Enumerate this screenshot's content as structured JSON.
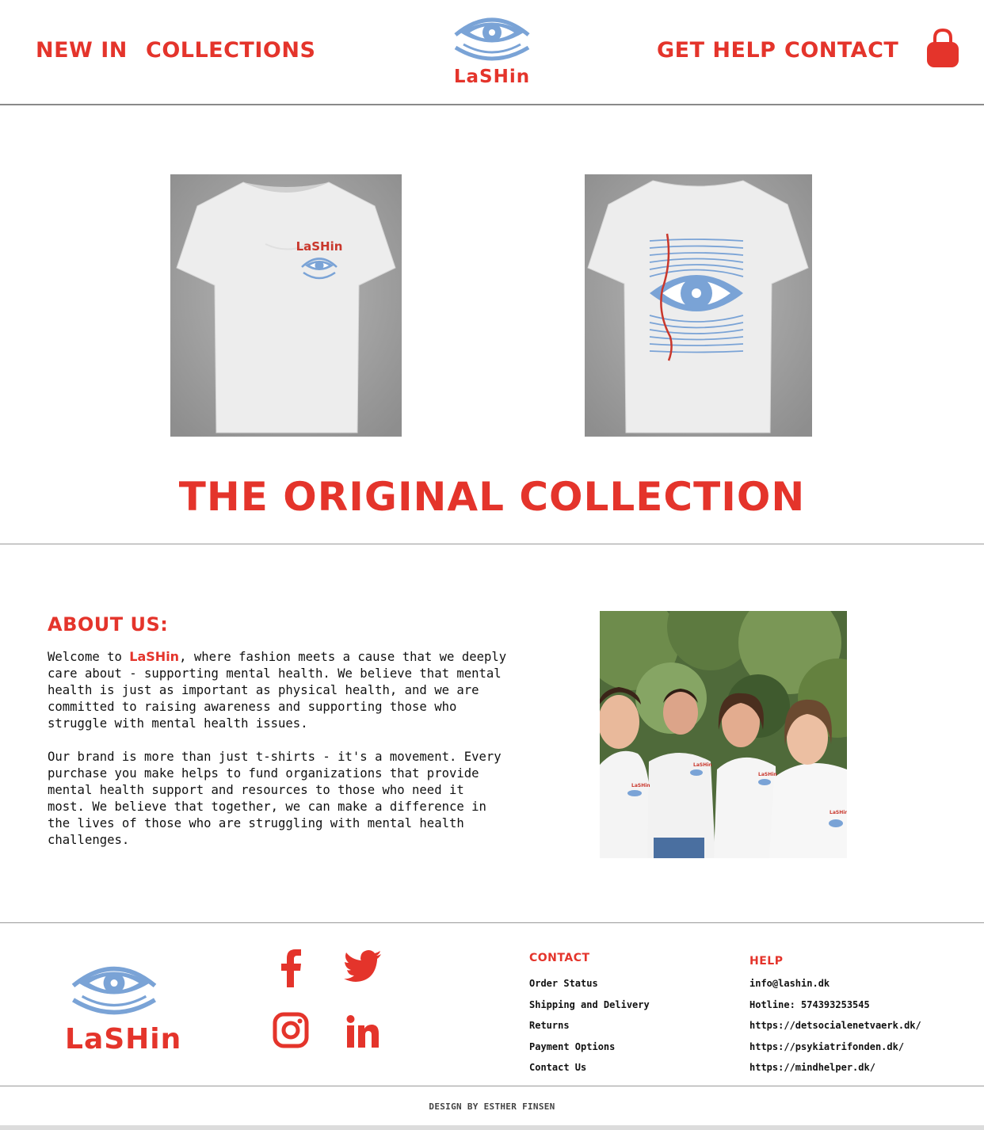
{
  "brand": {
    "name": "LaSHin",
    "accent": "#e4342b",
    "eye_blue": "#7aa3d6"
  },
  "nav": {
    "new_in": "NEW IN",
    "collections": "COLLECTIONS",
    "get_help": "GET HELP",
    "contact": "CONTACT",
    "bag_icon": "shopping-bag-icon"
  },
  "hero": {
    "products": [
      {
        "view": "front",
        "print_text": "LaSHin"
      },
      {
        "view": "back"
      }
    ],
    "title": "THE ORIGINAL COLLECTION"
  },
  "about": {
    "heading": "ABOUT US:",
    "p1_pre": "Welcome to ",
    "p1_brand": "LaSHin",
    "p1_post": ", where fashion meets a cause that we deeply care about - supporting mental health. We believe that mental health is just as important as physical health, and we are committed to raising awareness and supporting those who struggle with mental health issues.",
    "p2": "Our brand is more than just t-shirts - it's a movement. Every purchase you make helps to fund organizations that provide mental health support and resources to those who need it most. We believe that together, we can make a difference in the lives of those who are struggling with mental health challenges."
  },
  "footer": {
    "logo_text": "LaSHin",
    "social": [
      "facebook-icon",
      "twitter-icon",
      "instagram-icon",
      "linkedin-icon"
    ],
    "contact": {
      "title": "CONTACT",
      "items": [
        "Order Status",
        "Shipping and Delivery",
        "Returns",
        "Payment Options",
        "Contact Us"
      ]
    },
    "help": {
      "title": "HELP",
      "items": [
        "info@lashin.dk",
        "Hotline: 574393253545",
        "https://detsocialenetvaerk.dk/",
        "https://psykiatrifonden.dk/",
        "https://mindhelper.dk/"
      ]
    },
    "credit": "DESIGN BY ESTHER FINSEN"
  }
}
